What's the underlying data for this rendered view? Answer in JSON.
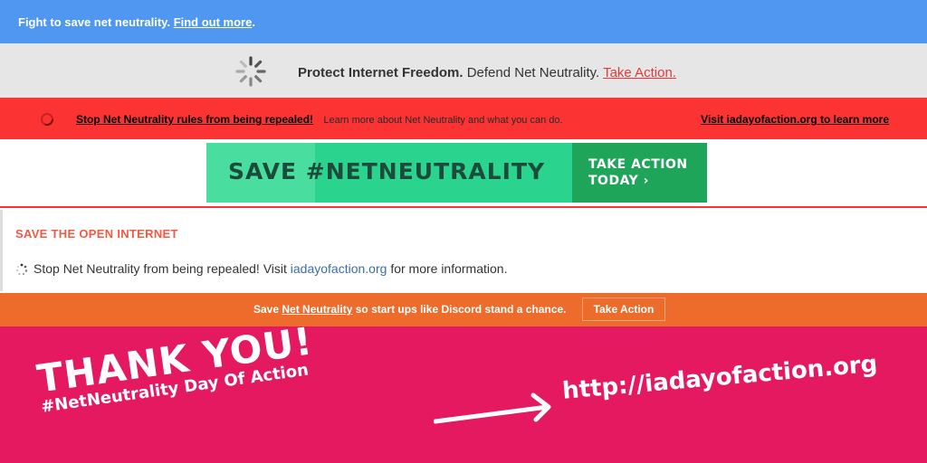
{
  "band1": {
    "text": "Fight to save net neutrality.",
    "link": "Find out more",
    "suffix": "."
  },
  "band2": {
    "strong": "Protect Internet Freedom.",
    "text": "Defend Net Neutrality.",
    "link": "Take Action."
  },
  "band3": {
    "link": "Stop Net Neutrality rules from being repealed!",
    "text": "Learn more about Net Neutrality and what you can do.",
    "right_link": "Visit iadayofaction.org to learn more"
  },
  "banner": {
    "label": "SAVE #NETNEUTRALITY",
    "cta_line1": "TAKE ACTION",
    "cta_line2": "TODAY",
    "cta_arrow": "›"
  },
  "band5": {
    "title": "SAVE THE OPEN INTERNET",
    "text": "Stop Net Neutrality from being repealed! Visit",
    "link": "iadayofaction.org",
    "suffix": "for more information."
  },
  "band6": {
    "prefix": "Save",
    "link": "Net Neutrality",
    "suffix": "so start ups like Discord stand a chance.",
    "button": "Take Action"
  },
  "footer": {
    "thank_you": "THANK YOU!",
    "subtitle": "#NetNeutrality Day Of Action",
    "url": "http://iadayofaction.org"
  },
  "colors": {
    "blue": "#4f97f1",
    "gray": "#e6e6e6",
    "red": "#fb3333",
    "green": "#2bd48e",
    "dark_green": "#1ea55a",
    "orange": "#ed6c2b",
    "pink": "#e5195f"
  }
}
